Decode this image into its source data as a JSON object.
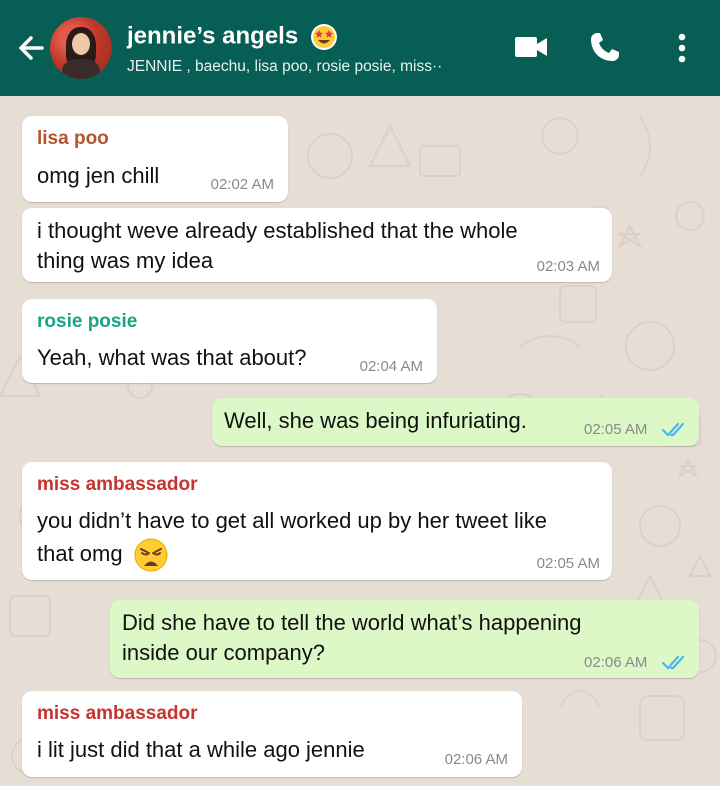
{
  "header": {
    "title": "jennie’s angels",
    "subtitle": "JENNIE , baechu, lisa poo, rosie posie, miss",
    "subtitle_more": "··"
  },
  "messages": [
    {
      "sender": "lisa poo",
      "text": "omg jen chill",
      "time": "02:02 AM",
      "direction": "in",
      "sender_color": "#b4542c"
    },
    {
      "sender": "",
      "text": "i thought weve already established that the whole thing was my idea",
      "time": "02:03 AM",
      "direction": "in"
    },
    {
      "sender": "rosie posie",
      "text": "Yeah, what was that about?",
      "time": "02:04 AM",
      "direction": "in",
      "sender_color": "#1aa384"
    },
    {
      "sender": "",
      "text": "Well, she was being infuriating.",
      "time": "02:05 AM",
      "direction": "out",
      "status": "read"
    },
    {
      "sender": "miss ambassador",
      "text": "you didn’t have to get all worked up by her tweet like that omg",
      "time": "02:05 AM",
      "direction": "in",
      "sender_color": "#c8332f",
      "emoji": "weary-face"
    },
    {
      "sender": "",
      "text": "Did she have to tell the world what’s happening inside our company?",
      "time": "02:06 AM",
      "direction": "out",
      "status": "read"
    },
    {
      "sender": "miss ambassador",
      "text": "i lit just did that a while ago jennie",
      "time": "02:06 AM",
      "direction": "in",
      "sender_color": "#c8332f"
    }
  ],
  "lines": {
    "m1": [
      "omg jen chill"
    ],
    "m2": [
      "i thought weve already established that the whole",
      "thing was my idea"
    ],
    "m3": [
      "Yeah, what was that about?"
    ],
    "m4": [
      "Well, she was being infuriating."
    ],
    "m5": [
      "you didn’t have to get all worked up by her tweet like",
      "that omg"
    ],
    "m6": [
      "Did she have to tell the world what’s happening",
      "inside our company?"
    ],
    "m7": [
      "i lit just did that a while ago jennie"
    ]
  },
  "colors": {
    "header": "#075e54",
    "chat_bg": "#e6ddd4",
    "incoming": "#ffffff",
    "outgoing": "#dcf8c6",
    "read_ticks": "#4fb6ec"
  }
}
